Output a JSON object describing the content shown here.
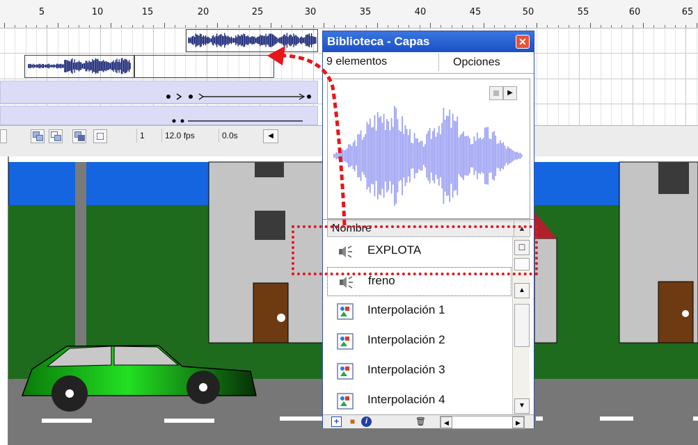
{
  "timeline": {
    "ruler_labels": [
      "5",
      "10",
      "15",
      "20",
      "25",
      "30",
      "35",
      "40",
      "45",
      "50",
      "55",
      "60",
      "65"
    ],
    "frame_field": "1",
    "fps_field": "12.0 fps",
    "time_field": "0.0s"
  },
  "library": {
    "title": "Biblioteca - Capas",
    "close_glyph": "✕",
    "count": "9 elementos",
    "options_label": "Opciones",
    "header_label": "Nombre",
    "items": [
      {
        "label": "EXPLOTA",
        "icon": "sound-icon"
      },
      {
        "label": "freno",
        "icon": "sound-icon"
      },
      {
        "label": "Interpolación 1",
        "icon": "graphic-symbol-icon"
      },
      {
        "label": "Interpolación 2",
        "icon": "graphic-symbol-icon"
      },
      {
        "label": "Interpolación 3",
        "icon": "graphic-symbol-icon"
      },
      {
        "label": "Interpolación 4",
        "icon": "graphic-symbol-icon"
      }
    ]
  },
  "colors": {
    "wave_preview": "#9b9ff2",
    "annotation": "#e8151a",
    "grass": "#1e6b1e",
    "sky": "#1565e0",
    "road": "#777777",
    "car": "#1ec41e"
  }
}
